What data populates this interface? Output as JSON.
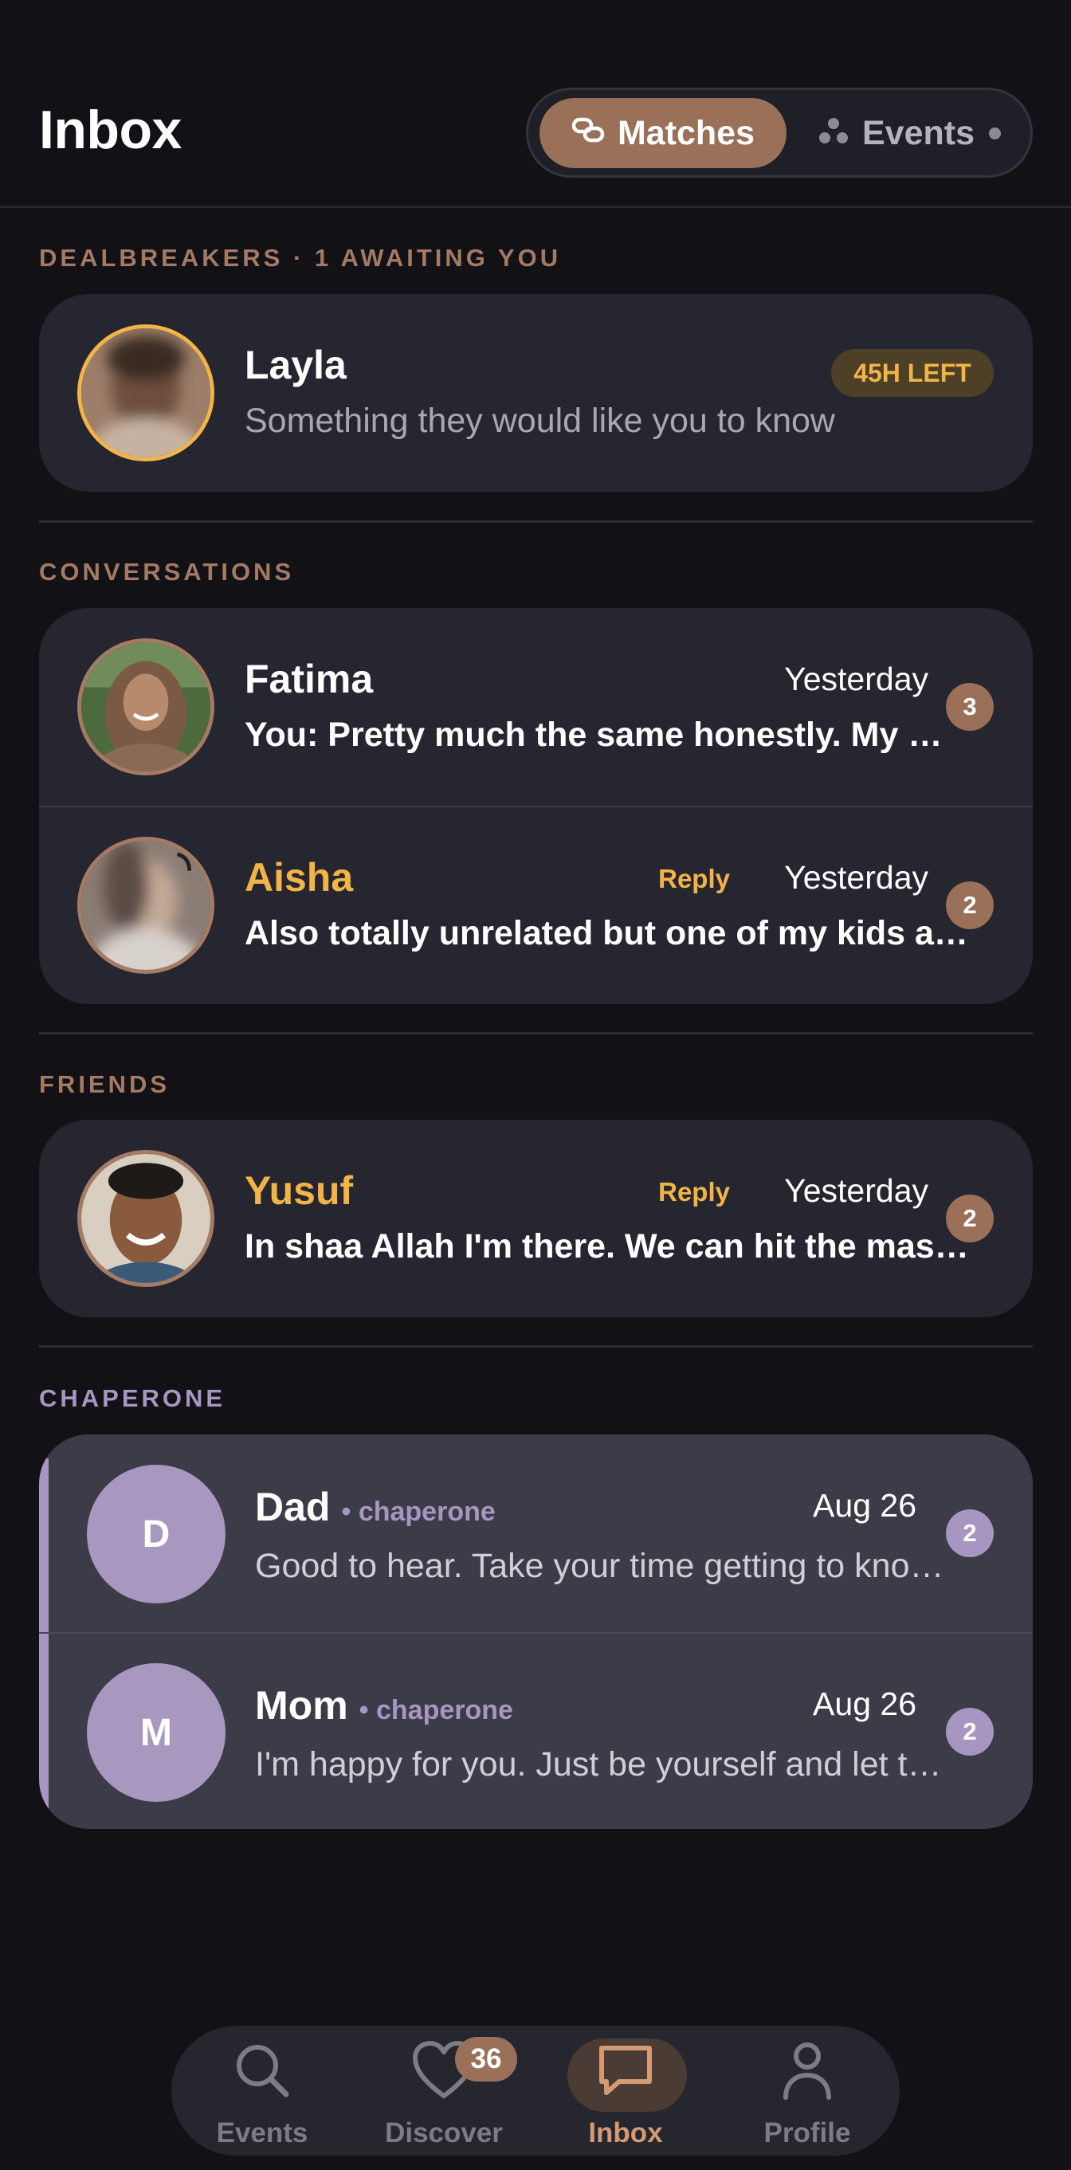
{
  "header": {
    "title": "Inbox",
    "segments": [
      {
        "label": "Matches",
        "icon": "link-icon",
        "active": true
      },
      {
        "label": "Events",
        "icon": "dots-icon",
        "active": false
      }
    ]
  },
  "sections": {
    "dealbreakers": {
      "label": "DEALBREAKERS · 1 AWAITING YOU",
      "item": {
        "name": "Layla",
        "preview": "Something they would like you to know",
        "pill": "45H LEFT"
      }
    },
    "conversations": {
      "label": "CONVERSATIONS",
      "items": [
        {
          "name": "Fatima",
          "time": "Yesterday",
          "preview": "You: Pretty much the same honestly. My mom is so excited lol",
          "unread": "3"
        },
        {
          "name": "Aisha",
          "reply": "Reply",
          "time": "Yesterday",
          "preview": "Also totally unrelated but one of my kids asked me today",
          "unread": "2"
        }
      ]
    },
    "friends": {
      "label": "FRIENDS",
      "items": [
        {
          "name": "Yusuf",
          "reply": "Reply",
          "time": "Yesterday",
          "preview": "In shaa Allah I'm there. We can hit the masjid after",
          "unread": "2"
        }
      ]
    },
    "chaperone": {
      "label": "CHAPERONE",
      "items": [
        {
          "initial": "D",
          "name": "Dad",
          "tag": "• chaperone",
          "time": "Aug 26",
          "preview": "Good to hear. Take your time getting to know her.",
          "unread": "2"
        },
        {
          "initial": "M",
          "name": "Mom",
          "tag": "• chaperone",
          "time": "Aug 26",
          "preview": "I'm happy for you. Just be yourself and let things unfold.",
          "unread": "2"
        }
      ]
    }
  },
  "tabbar": {
    "tabs": [
      {
        "label": "Events",
        "icon": "search-icon"
      },
      {
        "label": "Discover",
        "icon": "heart-icon"
      },
      {
        "label": "Inbox",
        "icon": "chat-icon",
        "active": true,
        "badge": "36"
      },
      {
        "label": "Profile",
        "icon": "person-icon"
      }
    ]
  },
  "colors": {
    "background": "#111116",
    "card": "#262631",
    "accent": "#9a7058",
    "gold": "#f2b447",
    "chaperone": "#a696c1"
  }
}
